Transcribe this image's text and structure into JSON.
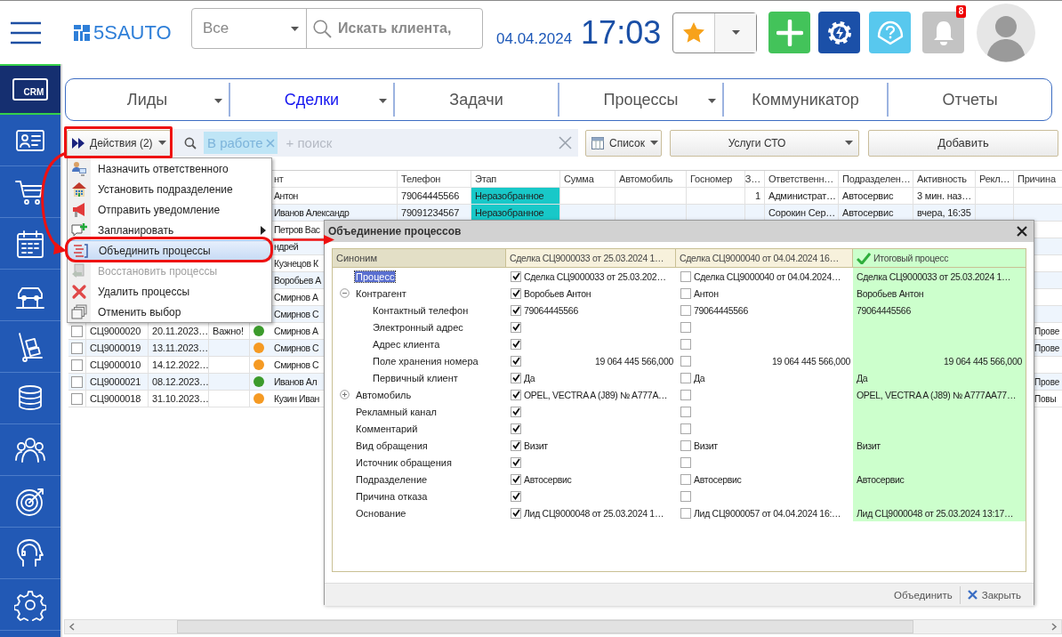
{
  "header": {
    "logo": "**5S**AUTO",
    "scope": "Все",
    "search_placeholder": "Искать клиента,",
    "date": "04.04.2024",
    "time": "17:03",
    "notification_count": "8"
  },
  "sidebar": {
    "items": [
      {
        "label": "CRM",
        "selected": true
      },
      {
        "selected": false
      },
      {
        "selected": false
      },
      {
        "selected": false
      },
      {
        "selected": false
      },
      {
        "selected": false
      },
      {
        "selected": false
      },
      {
        "selected": false
      },
      {
        "selected": false
      },
      {
        "selected": false
      },
      {
        "selected": false
      }
    ]
  },
  "nav": {
    "tabs": [
      {
        "label": "Лиды",
        "selected": false,
        "dropdown": true
      },
      {
        "label": "Сделки",
        "selected": true,
        "dropdown": true
      },
      {
        "label": "Задачи",
        "selected": false,
        "dropdown": false
      },
      {
        "label": "Процессы",
        "selected": false,
        "dropdown": true
      },
      {
        "label": "Коммуникатор",
        "selected": false,
        "dropdown": false
      },
      {
        "label": "Отчеты",
        "selected": false,
        "dropdown": false
      }
    ]
  },
  "toolbar": {
    "actions_button": "Действия (2)",
    "filter_tag": "В работе",
    "search_placeholder": "+ поиск",
    "view_button": "Список",
    "service_dropdown": "Услуги СТО",
    "add_button": "Добавить"
  },
  "table": {
    "columns": [
      "нт",
      "Телефон",
      "Этап",
      "Сумма",
      "Автомобиль",
      "Госномер",
      "З…",
      "Ответственн…",
      "Подразделен…",
      "Активность",
      "Рекл…",
      "Причина"
    ],
    "rows": [
      {
        "column_5": "Антон",
        "phone": "79064445566",
        "stage": "Неразобранное",
        "column_11": "1",
        "responsible": "Администрат…",
        "department": "Автосервис",
        "activity": "3 мин. наз…"
      },
      {
        "column_5": "Иванов Александр",
        "phone": "79091234567",
        "stage": "Неразобранное",
        "responsible": "Сорокин Сер…",
        "department": "Автосервис",
        "activity": "вчера, 16:35"
      },
      {
        "column_5": "Петров Вас"
      },
      {
        "column_5": "ндрей"
      },
      {
        "column_5": "Кузнецов К"
      },
      {
        "column_5": "Воробьев А"
      },
      {
        "column_5": "Смирнов А"
      },
      {
        "column_5": "Смирнов С"
      },
      {
        "checked": false,
        "column_2": "СЦ9000020",
        "column_3": "20.11.2023…",
        "column_4": "Важно!",
        "color": "#3c9b2c",
        "column_5": "Смирнов А",
        "column_16": "Прове"
      },
      {
        "checked": false,
        "column_2": "СЦ9000019",
        "column_3": "13.11.2023…",
        "color": "#f59a23",
        "column_5": "Смирнов С",
        "column_16": "Прове"
      },
      {
        "checked": false,
        "column_2": "СЦ9000010",
        "column_3": "14.12.2022…",
        "color": "#f59a23",
        "column_5": "Смирнов С"
      },
      {
        "checked": false,
        "column_2": "СЦ9000021",
        "column_3": "08.12.2023…",
        "color": "#3c9b2c",
        "column_5": "Иванов Ал",
        "column_16": "Прове"
      },
      {
        "checked": false,
        "column_2": "СЦ9000018",
        "column_3": "31.10.2023…",
        "color": "#f59a23",
        "column_5": "Кузин Иван",
        "column_16": "Повы"
      }
    ]
  },
  "actions_menu": {
    "items": [
      {
        "label": "Назначить ответственного",
        "selected": false,
        "disabled": false,
        "submenu": false
      },
      {
        "label": "Установить подразделение",
        "selected": false,
        "disabled": false,
        "submenu": false
      },
      {
        "label": "Отправить уведомление",
        "selected": false,
        "disabled": false,
        "submenu": false
      },
      {
        "label": "Запланировать",
        "selected": false,
        "disabled": false,
        "submenu": true
      },
      {
        "label": "Объединить процессы",
        "selected": true,
        "disabled": false,
        "submenu": false
      },
      {
        "label": "Восстановить процессы",
        "selected": false,
        "disabled": true,
        "submenu": false
      },
      {
        "label": "Удалить процессы",
        "selected": false,
        "disabled": false,
        "submenu": false
      },
      {
        "label": "Отменить выбор",
        "selected": false,
        "disabled": false,
        "submenu": false
      }
    ]
  },
  "merge_dialog": {
    "title": "Объединение процессов",
    "columns": [
      "Синоним",
      "Сделка СЦ9000033 от 25.03.2024 1…",
      "Сделка СЦ9000040 от 04.04.2024 16…",
      "Итоговый процесс"
    ],
    "rows": [
      {
        "label": "Процесс",
        "kind": "text",
        "selected": true,
        "sources": [
          {
            "checked": true,
            "value": "Сделка СЦ9000033 от 25.03.202…"
          },
          {
            "checked": false,
            "value": "Сделка СЦ9000040 от 04.04.2024…"
          }
        ],
        "result": "Сделка СЦ9000033 от 25.03.2024 1…"
      },
      {
        "label": "Контрагент",
        "kind": "text",
        "selected": false,
        "expanded": true,
        "sources": [
          {
            "checked": true,
            "value": "Воробьев Антон"
          },
          {
            "checked": false,
            "value": "Антон"
          }
        ],
        "result": "Воробьев Антон",
        "children": [
          {
            "label": "Контактный телефон",
            "kind": "text",
            "selected": false,
            "sources": [
              {
                "checked": true,
                "value": "79064445566"
              },
              {
                "checked": false,
                "value": "79064445566"
              }
            ],
            "result": "79064445566"
          },
          {
            "label": "Электронный адрес",
            "kind": "text",
            "selected": false,
            "sources": [
              {
                "checked": true
              },
              {
                "checked": false
              }
            ]
          },
          {
            "label": "Адрес клиента",
            "kind": "text",
            "selected": false,
            "sources": [
              {
                "checked": true
              },
              {
                "checked": false
              }
            ]
          },
          {
            "label": "Поле хранения номера",
            "kind": "number",
            "selected": false,
            "sources": [
              {
                "checked": true,
                "value": "19 064 445 566,000"
              },
              {
                "checked": false,
                "value": "19 064 445 566,000"
              }
            ],
            "result": "19 064 445 566,000"
          },
          {
            "label": "Первичный клиент",
            "kind": "text",
            "selected": false,
            "sources": [
              {
                "checked": true,
                "value": "Да"
              },
              {
                "checked": false,
                "value": "Да"
              }
            ],
            "result": "Да"
          }
        ]
      },
      {
        "label": "Автомобиль",
        "kind": "text",
        "selected": false,
        "expanded": false,
        "sources": [
          {
            "checked": true,
            "value": "OPEL, VECTRA A (J89) № A777A…"
          },
          {
            "checked": false
          }
        ],
        "result": "OPEL, VECTRA A (J89) № A777AA77…"
      },
      {
        "label": "Рекламный канал",
        "kind": "text",
        "selected": false,
        "sources": [
          {
            "checked": true
          },
          {
            "checked": false
          }
        ]
      },
      {
        "label": "Комментарий",
        "kind": "text",
        "selected": false,
        "sources": [
          {
            "checked": true
          },
          {
            "checked": false
          }
        ]
      },
      {
        "label": "Вид обращения",
        "kind": "text",
        "selected": false,
        "sources": [
          {
            "checked": true,
            "value": "Визит"
          },
          {
            "checked": false,
            "value": "Визит"
          }
        ],
        "result": "Визит"
      },
      {
        "label": "Источник обращения",
        "kind": "text",
        "selected": false,
        "sources": [
          {
            "checked": true
          },
          {
            "checked": false
          }
        ]
      },
      {
        "label": "Подразделение",
        "kind": "text",
        "selected": false,
        "sources": [
          {
            "checked": true,
            "value": "Автосервис"
          },
          {
            "checked": false,
            "value": "Автосервис"
          }
        ],
        "result": "Автосервис"
      },
      {
        "label": "Причина отказа",
        "kind": "text",
        "selected": false,
        "sources": [
          {
            "checked": true
          },
          {
            "checked": false
          }
        ]
      },
      {
        "label": "Основание",
        "kind": "text",
        "selected": false,
        "sources": [
          {
            "checked": true,
            "value": "Лид СЦ9000048 от 25.03.2024 1…"
          },
          {
            "checked": false,
            "value": "Лид СЦ9000057 от 04.04.2024 16:…"
          }
        ],
        "result": "Лид СЦ9000048 от 25.03.2024 13:17…"
      }
    ],
    "buttons": [
      {
        "label": "Объединить",
        "kind": "merge"
      },
      {
        "label": "Закрыть",
        "kind": "close"
      }
    ]
  }
}
